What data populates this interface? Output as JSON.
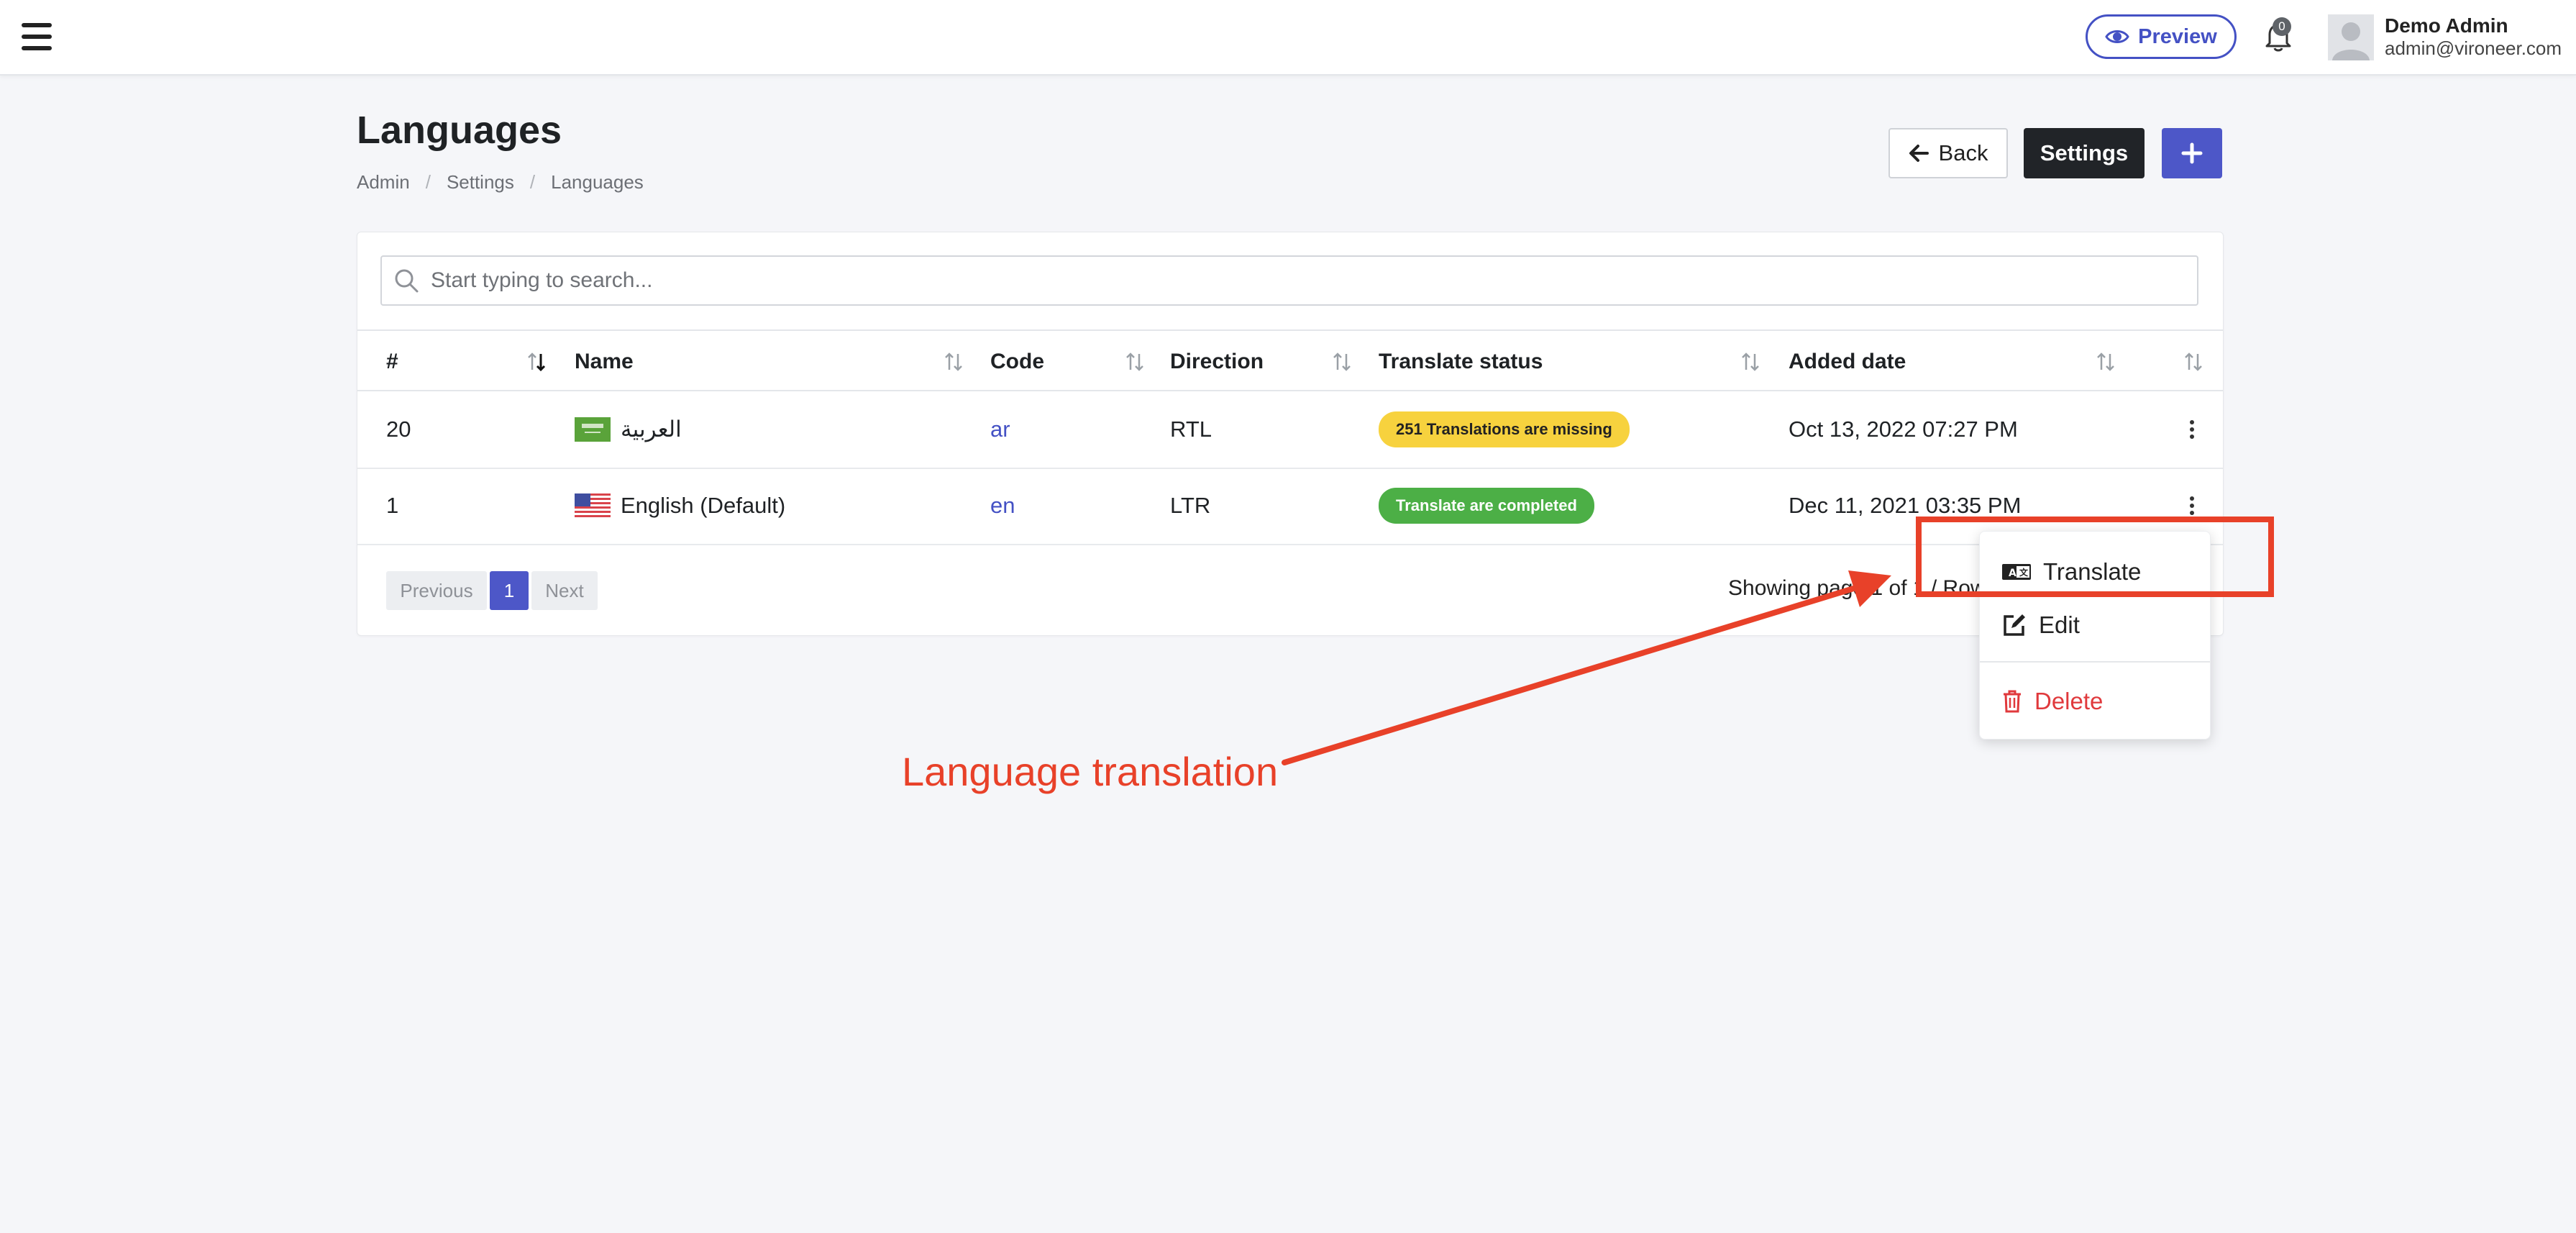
{
  "topbar": {
    "preview_label": "Preview",
    "notification_count": "0",
    "user_name": "Demo Admin",
    "user_email": "admin@vironeer.com"
  },
  "header": {
    "title": "Languages",
    "breadcrumb": [
      "Admin",
      "Settings",
      "Languages"
    ],
    "back_label": "Back",
    "settings_label": "Settings",
    "add_label": "+"
  },
  "search": {
    "placeholder": "Start typing to search..."
  },
  "table": {
    "columns": [
      "#",
      "Name",
      "Code",
      "Direction",
      "Translate status",
      "Added date"
    ],
    "rows": [
      {
        "id": "20",
        "flag": "saudi-arabia",
        "name": "العربية",
        "code": "ar",
        "direction": "RTL",
        "status": "251 Translations are missing",
        "status_type": "warning",
        "added": "Oct 13, 2022 07:27 PM"
      },
      {
        "id": "1",
        "flag": "united-states",
        "name": "English (Default)",
        "code": "en",
        "direction": "LTR",
        "status": "Translate are completed",
        "status_type": "success",
        "added": "Dec 11, 2021 03:35 PM"
      }
    ]
  },
  "pagination": {
    "previous": "Previous",
    "page": "1",
    "next": "Next",
    "showing": "Showing page 1 of 1 / Rows"
  },
  "dropdown": {
    "translate": "Translate",
    "edit": "Edit",
    "delete": "Delete"
  },
  "annotation": {
    "text": "Language translation",
    "color": "#e84129"
  },
  "colors": {
    "accent": "#4d57c8",
    "dark": "#212428",
    "warning": "#f7d23e",
    "success": "#4caf46",
    "danger": "#e0393c"
  }
}
